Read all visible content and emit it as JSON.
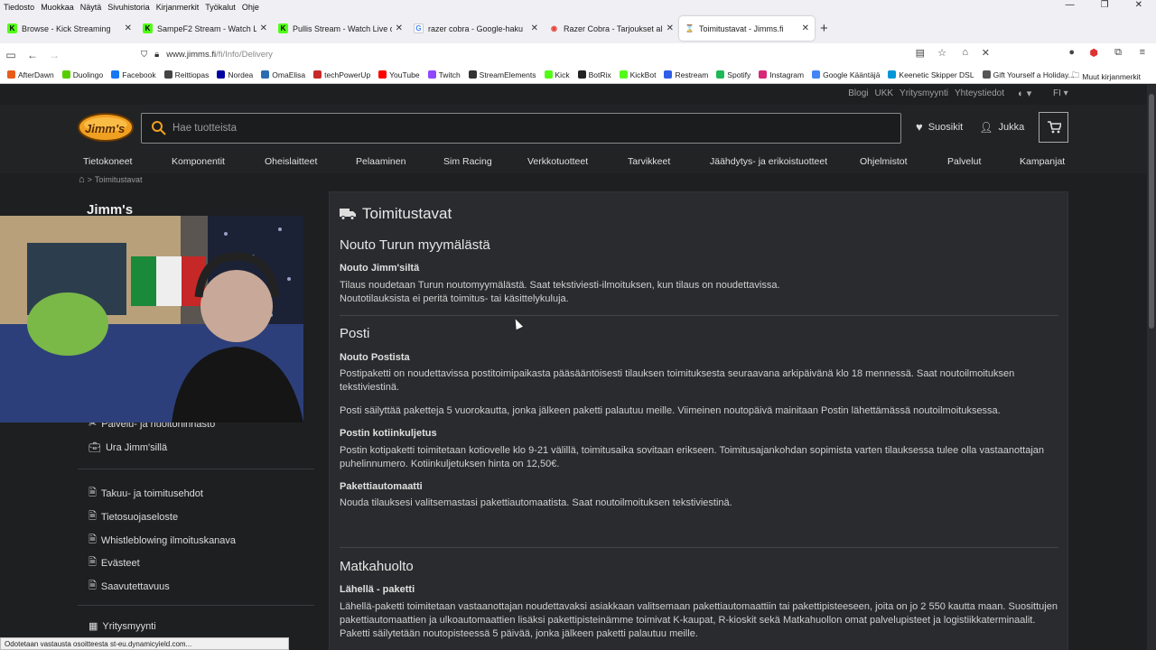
{
  "menubar": {
    "items": [
      "Tiedosto",
      "Muokkaa",
      "Näytä",
      "Sivuhistoria",
      "Kirjanmerkit",
      "Työkalut",
      "Ohje"
    ]
  },
  "tabs": [
    {
      "title": "Browse - Kick Streaming",
      "favicon_color": "#53fc18",
      "glyph": "K"
    },
    {
      "title": "SampeF2 Stream - Watch L",
      "favicon_color": "#53fc18",
      "glyph": "K"
    },
    {
      "title": "Pullis Stream - Watch Live o",
      "favicon_color": "#53fc18",
      "glyph": "K"
    },
    {
      "title": "razer cobra - Google-haku",
      "favicon_color": "#4285f4",
      "glyph": "G"
    },
    {
      "title": "Razer Cobra - Tarjoukset alk 36,",
      "favicon_color": "#e8453c",
      "glyph": "◉"
    },
    {
      "title": "Toimitustavat - Jimms.fi",
      "favicon_color": "#888888",
      "glyph": "J"
    }
  ],
  "url": {
    "host": "www.jimms.fi",
    "path": "/fi/Info/Delivery"
  },
  "bookmarks": [
    {
      "label": "AfterDawn",
      "color": "#e85c1a"
    },
    {
      "label": "Duolingo",
      "color": "#58cc02"
    },
    {
      "label": "Facebook",
      "color": "#1877f2"
    },
    {
      "label": "Reittiopas",
      "color": "#444444"
    },
    {
      "label": "Nordea",
      "color": "#0000a0"
    },
    {
      "label": "OmaElisa",
      "color": "#2b6cb0"
    },
    {
      "label": "techPowerUp",
      "color": "#c62828"
    },
    {
      "label": "YouTube",
      "color": "#ff0000"
    },
    {
      "label": "Twitch",
      "color": "#9146ff"
    },
    {
      "label": "StreamElements",
      "color": "#333333"
    },
    {
      "label": "Kick",
      "color": "#53fc18"
    },
    {
      "label": "BotRix",
      "color": "#222222"
    },
    {
      "label": "KickBot",
      "color": "#53fc18"
    },
    {
      "label": "Restream",
      "color": "#2f5ee8"
    },
    {
      "label": "Spotify",
      "color": "#1db954"
    },
    {
      "label": "Instagram",
      "color": "#d62976"
    },
    {
      "label": "Google Kääntäjä",
      "color": "#4285f4"
    },
    {
      "label": "Keenetic Skipper DSL",
      "color": "#0097d7"
    },
    {
      "label": "Gift Yourself a Holiday...",
      "color": "#555555"
    }
  ],
  "bookmarks_other": "Muut kirjanmerkit",
  "site": {
    "toplinks": [
      "Blogi",
      "UKK",
      "Yritysmyynti",
      "Yhteystiedot"
    ],
    "lang": "FI",
    "logo_text": "Jimm's",
    "search_placeholder": "Hae tuotteista",
    "favorites": "Suosikit",
    "user": "Jukka",
    "categories": [
      "Tietokoneet",
      "Komponentit",
      "Oheislaitteet",
      "Pelaaminen",
      "Sim Racing",
      "Verkkotuotteet",
      "Tarvikkeet",
      "Jäähdytys- ja erikoistuotteet",
      "Ohjelmistot",
      "Palvelut",
      "Kampanjat"
    ],
    "breadcrumb": "Toimitustavat",
    "accent": "#f0a020"
  },
  "sidebar": {
    "title": "Jimm's",
    "links_a": [
      "Palvelu- ja huoltohinnasto",
      "Ura Jimm'sillä"
    ],
    "links_b": [
      "Takuu- ja toimitusehdot",
      "Tietosuojaseloste",
      "Whistleblowing ilmoituskanava",
      "Evästeet",
      "Saavutettavuus"
    ],
    "links_c": [
      "Yritysmyynti"
    ]
  },
  "content": {
    "title": "Toimitustavat",
    "s1_h2": "Nouto Turun myymälästä",
    "s1_h3": "Nouto Jimm'siltä",
    "s1_p1": "Tilaus noudetaan Turun noutomyymälästä. Saat tekstiviesti-ilmoituksen, kun tilaus on noudettavissa.",
    "s1_p2": "Noutotilauksista ei peritä toimitus- tai käsittelykuluja.",
    "s2_h2": "Posti",
    "s2_h3a": "Nouto Postista",
    "s2_pa": "Postipaketti on noudettavissa postitoimipaikasta pääsääntöisesti tilauksen toimituksesta seuraavana arkipäivänä klo 18 mennessä. Saat noutoilmoituksen tekstiviestinä.",
    "s2_pb": "Posti säilyttää paketteja 5 vuorokautta, jonka jälkeen paketti palautuu meille. Viimeinen noutopäivä mainitaan Postin lähettämässä noutoilmoituksessa.",
    "s2_h3b": "Postin kotiinkuljetus",
    "s2_pc": "Postin kotipaketti toimitetaan kotiovelle klo 9-21 välillä, toimitusaika sovitaan erikseen. Toimitusajankohdan sopimista varten tilauksessa tulee olla vastaanottajan puhelinnumero. Kotiinkuljetuksen hinta on 12,50€.",
    "s2_h3c": "Pakettiautomaatti",
    "s2_pd": "Nouda tilauksesi valitsemastasi pakettiautomaatista. Saat noutoilmoituksen tekstiviestinä.",
    "s3_h2": "Matkahuolto",
    "s3_h3": "Lähellä - paketti",
    "s3_p": "Lähellä-paketti toimitetaan vastaanottajan noudettavaksi asiakkaan valitsemaan pakettiautomaattiin tai pakettipisteeseen, joita on jo 2 550 kautta maan. Suosittujen pakettiautomaattien ja ulkoautomaattien lisäksi pakettipisteinämme toimivat K-kaupat, R-kioskit sekä Matkahuollon omat palvelupisteet ja logistiikkaterminaalit. Paketti säilytetään noutopisteessä 5 päivää, jonka jälkeen paketti palautuu meille."
  },
  "status": "Odotetaan vastausta osoitteesta st-eu.dynamicyield.com..."
}
